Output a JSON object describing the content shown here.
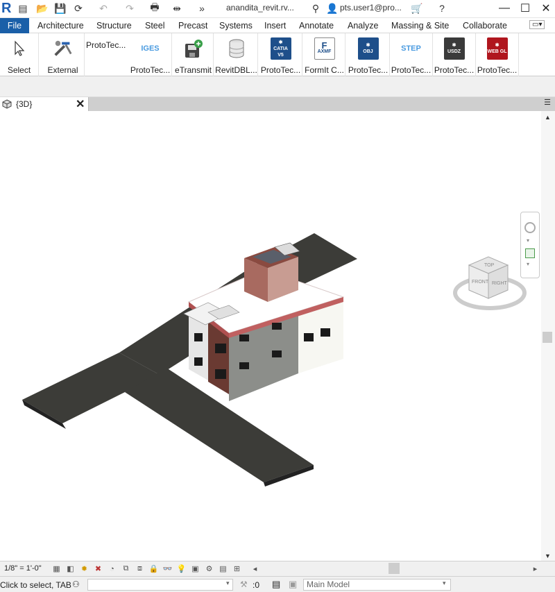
{
  "app": {
    "logo": "R",
    "file_title": "anandita_revit.rv...",
    "user": "pts.user1@pro..."
  },
  "menu": {
    "file": "File",
    "tabs": [
      "Architecture",
      "Structure",
      "Steel",
      "Precast",
      "Systems",
      "Insert",
      "Annotate",
      "Analyze",
      "Massing & Site",
      "Collaborate"
    ]
  },
  "ribbon": {
    "items": [
      {
        "label": "Select",
        "icon": "cursor-arrow-icon"
      },
      {
        "label": "External",
        "icon": "external-tools-icon"
      },
      {
        "label": "ProtoTec...",
        "icon": ""
      },
      {
        "label": "ProtoTec...",
        "icon": "iges-icon",
        "tile": "IGES"
      },
      {
        "label": "eTransmit",
        "icon": "etransmit-icon"
      },
      {
        "label": "RevitDBL...",
        "icon": "database-icon"
      },
      {
        "label": "ProtoTec...",
        "icon": "catia-icon",
        "tile": "CATIA V5"
      },
      {
        "label": "FormIt C...",
        "icon": "formit-icon",
        "tile": "AXMF"
      },
      {
        "label": "ProtoTec...",
        "icon": "obj-icon",
        "tile": "OBJ"
      },
      {
        "label": "ProtoTec...",
        "icon": "step-icon",
        "tile": "STEP"
      },
      {
        "label": "ProtoTec...",
        "icon": "usdz-icon",
        "tile": "USDZ"
      },
      {
        "label": "ProtoTec...",
        "icon": "webgl-icon",
        "tile": "WEB GL"
      }
    ]
  },
  "view_tab": {
    "title": "{3D}"
  },
  "viewcube": {
    "top": "TOP",
    "front": "FRONT",
    "right": "RIGHT"
  },
  "view_control": {
    "scale": "1/8\" = 1'-0\""
  },
  "status": {
    "text": "Click to select, TAB",
    "count": ":0",
    "model": "Main Model"
  },
  "colors": {
    "file_tab": "#1a5fa8",
    "road": "#3c3c38",
    "catia": "#1e4f8a",
    "usdz": "#3a3a3a",
    "webgl": "#b0161e",
    "obj": "#1e4f8a"
  }
}
